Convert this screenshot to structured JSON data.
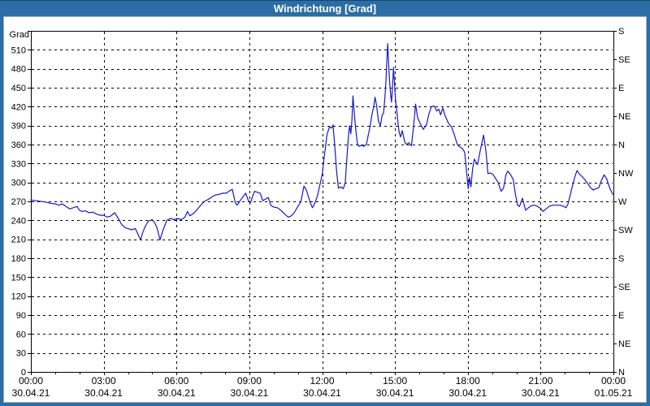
{
  "window": {
    "title": "Windrichtung [Grad]"
  },
  "colors": {
    "frame": "#2b6da4",
    "title_text": "#ffffff",
    "plot_background": "#ffffff",
    "grid": "#000000",
    "axis": "#000000",
    "line": "#1717c9",
    "label": "#000000"
  },
  "chart_data": {
    "type": "line",
    "title": "Windrichtung [Grad]",
    "ylabel": "Grad",
    "grid": "dashed",
    "y_axis": {
      "label": "Grad",
      "min": 0,
      "max": 540,
      "tick_step": 30,
      "tick_values": [
        0,
        30,
        60,
        90,
        120,
        150,
        180,
        210,
        240,
        270,
        300,
        330,
        360,
        390,
        420,
        450,
        480,
        510
      ]
    },
    "y2_axis": {
      "ticks": [
        {
          "value": 0,
          "label": "N"
        },
        {
          "value": 45,
          "label": "NE"
        },
        {
          "value": 90,
          "label": "E"
        },
        {
          "value": 135,
          "label": "SE"
        },
        {
          "value": 180,
          "label": "S"
        },
        {
          "value": 225,
          "label": "SW"
        },
        {
          "value": 270,
          "label": "W"
        },
        {
          "value": 315,
          "label": "NW"
        },
        {
          "value": 360,
          "label": "N"
        },
        {
          "value": 405,
          "label": "NE"
        },
        {
          "value": 450,
          "label": "E"
        },
        {
          "value": 495,
          "label": "SE"
        },
        {
          "value": 540,
          "label": "S"
        }
      ]
    },
    "x_axis": {
      "min_hour": 0,
      "max_hour": 24,
      "minor_tick_hours": 1,
      "ticks": [
        {
          "hour": 0,
          "time": "00:00",
          "date": "30.04.21"
        },
        {
          "hour": 3,
          "time": "03:00",
          "date": "30.04.21"
        },
        {
          "hour": 6,
          "time": "06:00",
          "date": "30.04.21"
        },
        {
          "hour": 9,
          "time": "09:00",
          "date": "30.04.21"
        },
        {
          "hour": 12,
          "time": "12:00",
          "date": "30.04.21"
        },
        {
          "hour": 15,
          "time": "15:00",
          "date": "30.04.21"
        },
        {
          "hour": 18,
          "time": "18:00",
          "date": "30.04.21"
        },
        {
          "hour": 21,
          "time": "21:00",
          "date": "30.04.21"
        },
        {
          "hour": 24,
          "time": "00:00",
          "date": "01.05.21"
        }
      ]
    },
    "series": [
      {
        "name": "Windrichtung",
        "color": "#1717c9",
        "points": [
          [
            0,
            272
          ],
          [
            0.2,
            271
          ],
          [
            0.4,
            270
          ],
          [
            0.6,
            269
          ],
          [
            0.8,
            267
          ],
          [
            1,
            266
          ],
          [
            1.15,
            264
          ],
          [
            1.3,
            266
          ],
          [
            1.45,
            262
          ],
          [
            1.6,
            258
          ],
          [
            1.75,
            260
          ],
          [
            1.9,
            262
          ],
          [
            2,
            256
          ],
          [
            2.1,
            254
          ],
          [
            2.25,
            255
          ],
          [
            2.4,
            252
          ],
          [
            2.55,
            253
          ],
          [
            2.7,
            250
          ],
          [
            2.85,
            248
          ],
          [
            3,
            248
          ],
          [
            3.15,
            245
          ],
          [
            3.3,
            247
          ],
          [
            3.45,
            252
          ],
          [
            3.6,
            243
          ],
          [
            3.75,
            233
          ],
          [
            3.9,
            228
          ],
          [
            4,
            227
          ],
          [
            4.15,
            225
          ],
          [
            4.3,
            227
          ],
          [
            4.45,
            215
          ],
          [
            4.52,
            209
          ],
          [
            4.62,
            222
          ],
          [
            4.72,
            231
          ],
          [
            4.85,
            239
          ],
          [
            5,
            241
          ],
          [
            5.1,
            236
          ],
          [
            5.2,
            228
          ],
          [
            5.32,
            209
          ],
          [
            5.45,
            225
          ],
          [
            5.6,
            240
          ],
          [
            5.75,
            243
          ],
          [
            5.9,
            241
          ],
          [
            6.05,
            243
          ],
          [
            6.2,
            241
          ],
          [
            6.35,
            245
          ],
          [
            6.45,
            254
          ],
          [
            6.55,
            247
          ],
          [
            6.7,
            251
          ],
          [
            6.85,
            257
          ],
          [
            7,
            264
          ],
          [
            7.15,
            270
          ],
          [
            7.3,
            273
          ],
          [
            7.45,
            277
          ],
          [
            7.6,
            280
          ],
          [
            7.75,
            281
          ],
          [
            7.9,
            283
          ],
          [
            8.05,
            283
          ],
          [
            8.2,
            287
          ],
          [
            8.3,
            289
          ],
          [
            8.42,
            268
          ],
          [
            8.5,
            264
          ],
          [
            8.62,
            271
          ],
          [
            8.75,
            278
          ],
          [
            8.85,
            283
          ],
          [
            8.95,
            272
          ],
          [
            9.05,
            268
          ],
          [
            9.15,
            280
          ],
          [
            9.22,
            286
          ],
          [
            9.35,
            284
          ],
          [
            9.45,
            283
          ],
          [
            9.55,
            271
          ],
          [
            9.68,
            274
          ],
          [
            9.78,
            276
          ],
          [
            9.88,
            264
          ],
          [
            10,
            261
          ],
          [
            10.15,
            260
          ],
          [
            10.3,
            256
          ],
          [
            10.45,
            250
          ],
          [
            10.6,
            245
          ],
          [
            10.72,
            247
          ],
          [
            10.85,
            252
          ],
          [
            11,
            262
          ],
          [
            11.12,
            269
          ],
          [
            11.25,
            294
          ],
          [
            11.35,
            288
          ],
          [
            11.5,
            269
          ],
          [
            11.6,
            260
          ],
          [
            11.7,
            267
          ],
          [
            11.8,
            278
          ],
          [
            11.9,
            295
          ],
          [
            12,
            312
          ],
          [
            12.1,
            345
          ],
          [
            12.2,
            376
          ],
          [
            12.3,
            388
          ],
          [
            12.38,
            386
          ],
          [
            12.45,
            391
          ],
          [
            12.52,
            358
          ],
          [
            12.6,
            316
          ],
          [
            12.67,
            291
          ],
          [
            12.77,
            293
          ],
          [
            12.87,
            290
          ],
          [
            12.95,
            299
          ],
          [
            13.02,
            340
          ],
          [
            13.08,
            372
          ],
          [
            13.13,
            390
          ],
          [
            13.18,
            377
          ],
          [
            13.23,
            400
          ],
          [
            13.27,
            437
          ],
          [
            13.32,
            412
          ],
          [
            13.38,
            386
          ],
          [
            13.45,
            362
          ],
          [
            13.52,
            357
          ],
          [
            13.62,
            359
          ],
          [
            13.72,
            357
          ],
          [
            13.82,
            360
          ],
          [
            13.9,
            375
          ],
          [
            13.97,
            388
          ],
          [
            14.05,
            407
          ],
          [
            14.12,
            419
          ],
          [
            14.18,
            435
          ],
          [
            14.25,
            420
          ],
          [
            14.32,
            397
          ],
          [
            14.4,
            390
          ],
          [
            14.47,
            406
          ],
          [
            14.53,
            410
          ],
          [
            14.58,
            432
          ],
          [
            14.63,
            462
          ],
          [
            14.67,
            498
          ],
          [
            14.7,
            520
          ],
          [
            14.74,
            486
          ],
          [
            14.78,
            458
          ],
          [
            14.82,
            440
          ],
          [
            14.86,
            427
          ],
          [
            14.9,
            452
          ],
          [
            14.94,
            482
          ],
          [
            14.98,
            458
          ],
          [
            15.02,
            432
          ],
          [
            15.07,
            415
          ],
          [
            15.12,
            396
          ],
          [
            15.17,
            380
          ],
          [
            15.23,
            372
          ],
          [
            15.3,
            382
          ],
          [
            15.4,
            364
          ],
          [
            15.48,
            360
          ],
          [
            15.57,
            363
          ],
          [
            15.68,
            358
          ],
          [
            15.77,
            390
          ],
          [
            15.85,
            424
          ],
          [
            15.93,
            403
          ],
          [
            16.03,
            394
          ],
          [
            16.17,
            384
          ],
          [
            16.3,
            392
          ],
          [
            16.4,
            409
          ],
          [
            16.5,
            420
          ],
          [
            16.62,
            421
          ],
          [
            16.72,
            413
          ],
          [
            16.8,
            416
          ],
          [
            16.88,
            407
          ],
          [
            16.97,
            418
          ],
          [
            17.07,
            405
          ],
          [
            17.2,
            394
          ],
          [
            17.33,
            388
          ],
          [
            17.45,
            375
          ],
          [
            17.57,
            360
          ],
          [
            17.67,
            356
          ],
          [
            17.77,
            354
          ],
          [
            17.87,
            348
          ],
          [
            17.95,
            316
          ],
          [
            18.02,
            290
          ],
          [
            18.07,
            308
          ],
          [
            18.13,
            293
          ],
          [
            18.2,
            322
          ],
          [
            18.27,
            337
          ],
          [
            18.4,
            328
          ],
          [
            18.52,
            352
          ],
          [
            18.65,
            375
          ],
          [
            18.75,
            348
          ],
          [
            18.83,
            314
          ],
          [
            18.93,
            315
          ],
          [
            19.03,
            313
          ],
          [
            19.15,
            306
          ],
          [
            19.25,
            300
          ],
          [
            19.37,
            286
          ],
          [
            19.47,
            291
          ],
          [
            19.57,
            312
          ],
          [
            19.65,
            318
          ],
          [
            19.75,
            313
          ],
          [
            19.87,
            305
          ],
          [
            19.95,
            284
          ],
          [
            20.05,
            264
          ],
          [
            20.13,
            262
          ],
          [
            20.25,
            275
          ],
          [
            20.38,
            256
          ],
          [
            20.5,
            260
          ],
          [
            20.62,
            263
          ],
          [
            20.75,
            264
          ],
          [
            20.87,
            262
          ],
          [
            21,
            259
          ],
          [
            21.1,
            254
          ],
          [
            21.22,
            258
          ],
          [
            21.35,
            262
          ],
          [
            21.5,
            264
          ],
          [
            21.65,
            264
          ],
          [
            21.8,
            264
          ],
          [
            21.95,
            262
          ],
          [
            22.05,
            260
          ],
          [
            22.13,
            266
          ],
          [
            22.22,
            280
          ],
          [
            22.32,
            296
          ],
          [
            22.42,
            310
          ],
          [
            22.5,
            319
          ],
          [
            22.6,
            313
          ],
          [
            22.72,
            309
          ],
          [
            22.83,
            304
          ],
          [
            22.95,
            298
          ],
          [
            23.05,
            292
          ],
          [
            23.17,
            288
          ],
          [
            23.28,
            290
          ],
          [
            23.4,
            292
          ],
          [
            23.5,
            303
          ],
          [
            23.62,
            312
          ],
          [
            23.72,
            306
          ],
          [
            23.85,
            291
          ],
          [
            23.95,
            283
          ],
          [
            24,
            281
          ]
        ]
      }
    ]
  }
}
